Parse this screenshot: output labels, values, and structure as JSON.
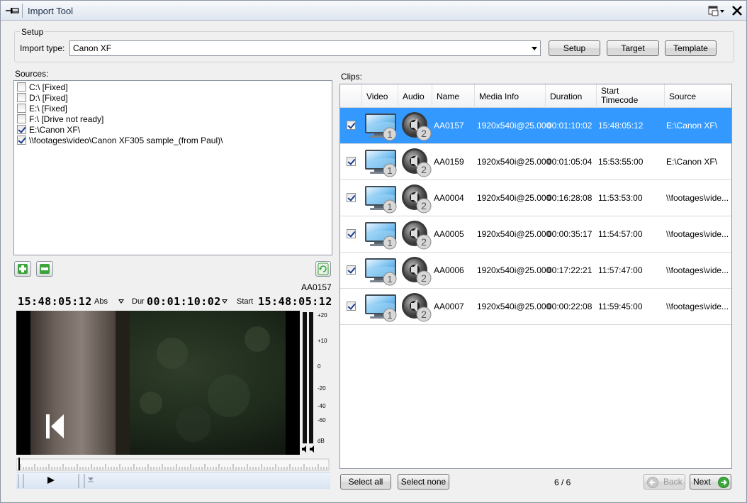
{
  "window": {
    "title": "Import Tool"
  },
  "setup": {
    "group_label": "Setup",
    "import_type_label": "Import type:",
    "import_type_value": "Canon XF",
    "buttons": {
      "setup": "Setup",
      "target": "Target",
      "template": "Template"
    }
  },
  "sources": {
    "label": "Sources:",
    "items": [
      {
        "label": "C:\\ [Fixed]",
        "checked": false
      },
      {
        "label": "D:\\ [Fixed]",
        "checked": false
      },
      {
        "label": "E:\\ [Fixed]",
        "checked": false
      },
      {
        "label": "F:\\ [Drive not ready]",
        "checked": false
      },
      {
        "label": "E:\\Canon XF\\",
        "checked": true
      },
      {
        "label": "\\\\footages\\video\\Canon XF305 sample_(from Paul)\\",
        "checked": true
      }
    ]
  },
  "preview": {
    "clip_name": "AA0157",
    "abs_timecode": "15:48:05:12",
    "abs_label": "Abs",
    "dur_label": "Dur",
    "dur_timecode": "00:01:10:02",
    "start_label": "Start",
    "start_timecode": "15:48:05:12",
    "meter_labels": [
      "+20",
      "+10",
      "0",
      "-20",
      "-40",
      "-60",
      "dB"
    ]
  },
  "clips": {
    "label": "Clips:",
    "columns": {
      "video": "Video",
      "audio": "Audio",
      "name": "Name",
      "media_info": "Media Info",
      "duration": "Duration",
      "start_tc_1": "Start",
      "start_tc_2": "Timecode",
      "source": "Source"
    },
    "rows": [
      {
        "checked": true,
        "selected": true,
        "video_badge": "1",
        "audio_badge": "2",
        "name": "AA0157",
        "media_info": "1920x540i@25.000",
        "duration": "00:01:10:02",
        "start_tc": "15:48:05:12",
        "source": "E:\\Canon XF\\"
      },
      {
        "checked": true,
        "selected": false,
        "video_badge": "1",
        "audio_badge": "2",
        "name": "AA0159",
        "media_info": "1920x540i@25.000",
        "duration": "00:01:05:04",
        "start_tc": "15:53:55:00",
        "source": "E:\\Canon XF\\"
      },
      {
        "checked": true,
        "selected": false,
        "video_badge": "1",
        "audio_badge": "2",
        "name": "AA0004",
        "media_info": "1920x540i@25.000",
        "duration": "00:16:28:08",
        "start_tc": "11:53:53:00",
        "source": "\\\\footages\\vide..."
      },
      {
        "checked": true,
        "selected": false,
        "video_badge": "1",
        "audio_badge": "2",
        "name": "AA0005",
        "media_info": "1920x540i@25.000",
        "duration": "00:00:35:17",
        "start_tc": "11:54:57:00",
        "source": "\\\\footages\\vide..."
      },
      {
        "checked": true,
        "selected": false,
        "video_badge": "1",
        "audio_badge": "2",
        "name": "AA0006",
        "media_info": "1920x540i@25.000",
        "duration": "00:17:22:21",
        "start_tc": "11:57:47:00",
        "source": "\\\\footages\\vide..."
      },
      {
        "checked": true,
        "selected": false,
        "video_badge": "1",
        "audio_badge": "2",
        "name": "AA0007",
        "media_info": "1920x540i@25.000",
        "duration": "00:00:22:08",
        "start_tc": "11:59:45:00",
        "source": "\\\\footages\\vide..."
      }
    ],
    "select_all": "Select all",
    "select_none": "Select none",
    "count": "6 / 6",
    "back": "Back",
    "next": "Next"
  },
  "colors": {
    "selection": "#3399ff",
    "next_arrow": "#3aa83a"
  }
}
